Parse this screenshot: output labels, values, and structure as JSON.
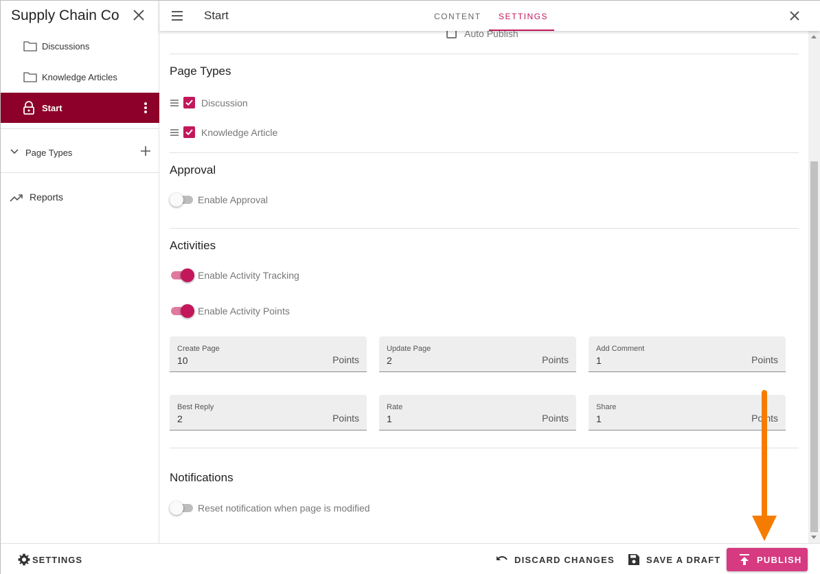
{
  "sidebar": {
    "title": "Supply Chain Co",
    "items": [
      {
        "label": "Discussions",
        "icon": "folder-icon"
      },
      {
        "label": "Knowledge Articles",
        "icon": "folder-icon"
      },
      {
        "label": "Start",
        "icon": "lock-icon",
        "active": true
      }
    ],
    "page_types_label": "Page Types",
    "reports_label": "Reports"
  },
  "topbar": {
    "title": "Start",
    "tabs": [
      {
        "label": "CONTENT",
        "active": false
      },
      {
        "label": "SETTINGS",
        "active": true
      }
    ]
  },
  "settings": {
    "auto_publish_label": "Auto Publish",
    "page_types": {
      "title": "Page Types",
      "items": [
        {
          "label": "Discussion",
          "checked": true
        },
        {
          "label": "Knowledge Article",
          "checked": true
        }
      ]
    },
    "approval": {
      "title": "Approval",
      "toggle_label": "Enable Approval",
      "enabled": false
    },
    "activities": {
      "title": "Activities",
      "tracking_label": "Enable Activity Tracking",
      "tracking_enabled": true,
      "points_label": "Enable Activity Points",
      "points_enabled": true,
      "fields": [
        {
          "label": "Create Page",
          "value": "10",
          "suffix": "Points"
        },
        {
          "label": "Update Page",
          "value": "2",
          "suffix": "Points"
        },
        {
          "label": "Add Comment",
          "value": "1",
          "suffix": "Points"
        },
        {
          "label": "Best Reply",
          "value": "2",
          "suffix": "Points"
        },
        {
          "label": "Rate",
          "value": "1",
          "suffix": "Points"
        },
        {
          "label": "Share",
          "value": "1",
          "suffix": "Points"
        }
      ]
    },
    "notifications": {
      "title": "Notifications",
      "toggle_label": "Reset notification when page is modified",
      "enabled": false
    }
  },
  "footer": {
    "settings_label": "SETTINGS",
    "discard_label": "DISCARD CHANGES",
    "save_draft_label": "SAVE A DRAFT",
    "publish_label": "PUBLISH"
  },
  "colors": {
    "brand": "#8c0029",
    "accent": "#c2185b",
    "publish_button": "#d63a80",
    "annotation_arrow": "#f57c00"
  }
}
